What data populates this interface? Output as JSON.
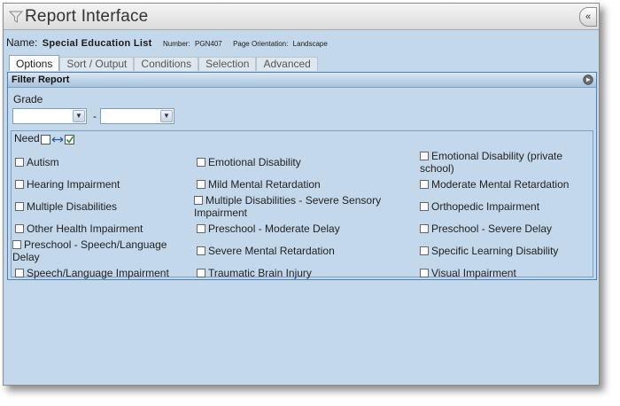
{
  "window": {
    "title": "Report Interface"
  },
  "report": {
    "name_label": "Name:",
    "name_value": "Special Education List",
    "number_label": "Number:",
    "number_value": "PGN407",
    "orientation_label": "Page Orientation:",
    "orientation_value": "Landscape"
  },
  "tabs": [
    {
      "label": "Options",
      "active": true
    },
    {
      "label": "Sort / Output"
    },
    {
      "label": "Conditions"
    },
    {
      "label": "Selection"
    },
    {
      "label": "Advanced"
    }
  ],
  "filter": {
    "title": "Filter Report",
    "grade_label": "Grade",
    "grade_from": "",
    "grade_to": "",
    "range_separator": "-",
    "need_label": "Need",
    "options": [
      "Autism",
      "Emotional Disability",
      "Emotional Disability (private school)",
      "Hearing Impairment",
      "Mild Mental Retardation",
      "Moderate Mental Retardation",
      "Multiple Disabilities",
      "Multiple Disabilities - Severe Sensory Impairment",
      "Orthopedic Impairment",
      "Other Health Impairment",
      "Preschool - Moderate Delay",
      "Preschool - Severe Delay",
      "Preschool - Speech/Language Delay",
      "Severe Mental Retardation",
      "Specific Learning Disability",
      "Speech/Language Impairment",
      "Traumatic Brain Injury",
      "Visual Impairment"
    ]
  },
  "colors": {
    "background": "#c3d8ea",
    "header_gradient_top": "#d9e6f2",
    "header_gradient_bottom": "#a7c3dd",
    "border": "#4d7fb1"
  }
}
